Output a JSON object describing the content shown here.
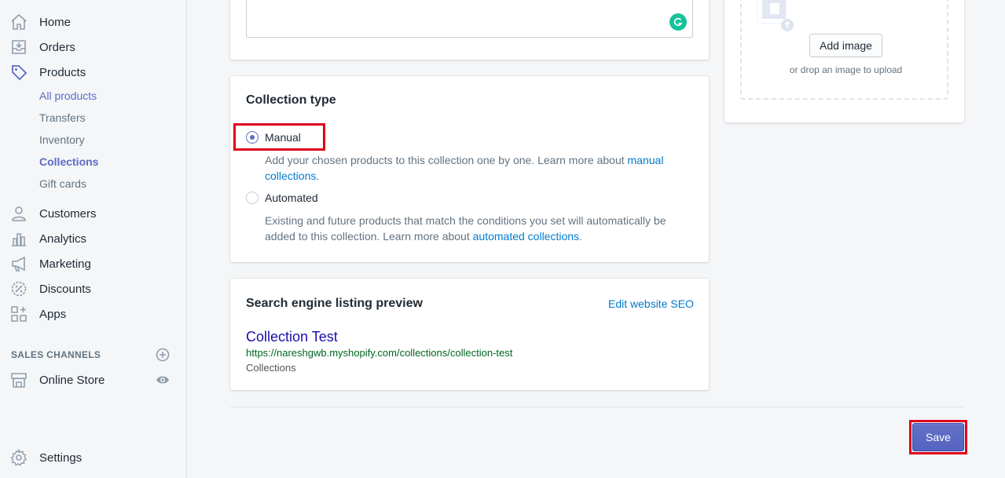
{
  "sidebar": {
    "items": [
      {
        "label": "Home",
        "icon": "home-icon"
      },
      {
        "label": "Orders",
        "icon": "orders-icon"
      },
      {
        "label": "Products",
        "icon": "tag-icon"
      }
    ],
    "product_sub": [
      {
        "label": "All products"
      },
      {
        "label": "Transfers"
      },
      {
        "label": "Inventory"
      },
      {
        "label": "Collections"
      },
      {
        "label": "Gift cards"
      }
    ],
    "items2": [
      {
        "label": "Customers",
        "icon": "customers-icon"
      },
      {
        "label": "Analytics",
        "icon": "analytics-icon"
      },
      {
        "label": "Marketing",
        "icon": "megaphone-icon"
      },
      {
        "label": "Discounts",
        "icon": "discount-icon"
      },
      {
        "label": "Apps",
        "icon": "apps-icon"
      }
    ],
    "sales_channels_heading": "SALES CHANNELS",
    "online_store": "Online Store",
    "settings": "Settings"
  },
  "collection_type": {
    "title": "Collection type",
    "manual": {
      "label": "Manual",
      "help": "Add your chosen products to this collection one by one. Learn more about ",
      "link": "manual collections",
      "end": "."
    },
    "automated": {
      "label": "Automated",
      "help": "Existing and future products that match the conditions you set will automatically be added to this collection. Learn more about ",
      "link": "automated collections",
      "end": "."
    }
  },
  "seo": {
    "title": "Search engine listing preview",
    "edit_link": "Edit website SEO",
    "page_title": "Collection Test",
    "url": "https://nareshgwb.myshopify.com/collections/collection-test",
    "description": "Collections"
  },
  "image": {
    "add_button": "Add image",
    "drop_hint": "or drop an image to upload"
  },
  "save_label": "Save",
  "colors": {
    "accent": "#5c6ac4",
    "link": "#007ace",
    "highlight": "#e0001b"
  }
}
